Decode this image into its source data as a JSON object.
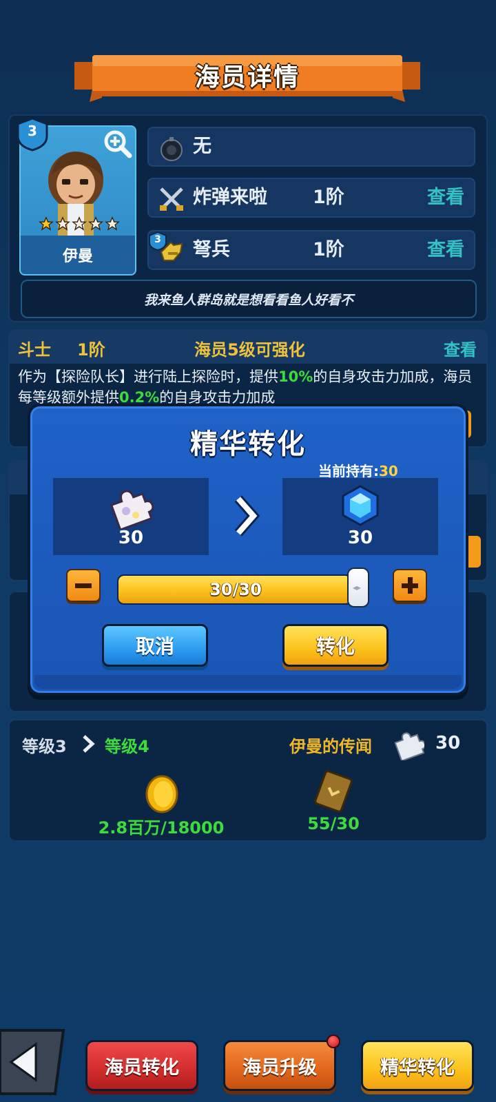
{
  "header": {
    "title": "海员详情"
  },
  "crew": {
    "level": "3",
    "name": "伊曼",
    "stars": 5,
    "filled_stars": 1
  },
  "info_rows": [
    {
      "label": "无",
      "tier": "",
      "view": ""
    },
    {
      "label": "炸弹来啦",
      "tier": "1阶",
      "view": "查看"
    },
    {
      "label": "弩兵",
      "tier": "1阶",
      "view": "查看",
      "badge": "3"
    }
  ],
  "quote": "我来鱼人群岛就是想看看鱼人好看不",
  "skill": {
    "name": "斗士",
    "tier": "1阶",
    "condition": "海员5级可强化",
    "view": "查看",
    "desc_parts": [
      "作为【探险队长】进行陆上探险时，提供",
      "10%",
      "的自身攻击力加成，海员每等级额外提供",
      "0.2%",
      "的自身攻击力加成"
    ]
  },
  "level_panel": {
    "from": "等级3",
    "to": "等级4",
    "rumor_label": "伊曼的传闻",
    "rumor_count": "30",
    "coin_cost": "2.8百万/18000",
    "book_cost": "55/30"
  },
  "modal": {
    "title": "精华转化",
    "hold_label": "当前持有:",
    "hold_value": "30",
    "from_amount": "30",
    "to_amount": "30",
    "slider_text": "30/30",
    "slider_fraction": 1.0,
    "cancel_label": "取消",
    "confirm_label": "转化"
  },
  "bottom_bar": {
    "btn1": "海员转化",
    "btn2": "海员升级",
    "btn3": "精华转化"
  },
  "colors": {
    "accent_green": "#3ddc3d",
    "accent_gold": "#f0c23a",
    "view_teal": "#33c1c8",
    "modal_blue": "#1f62c8"
  }
}
